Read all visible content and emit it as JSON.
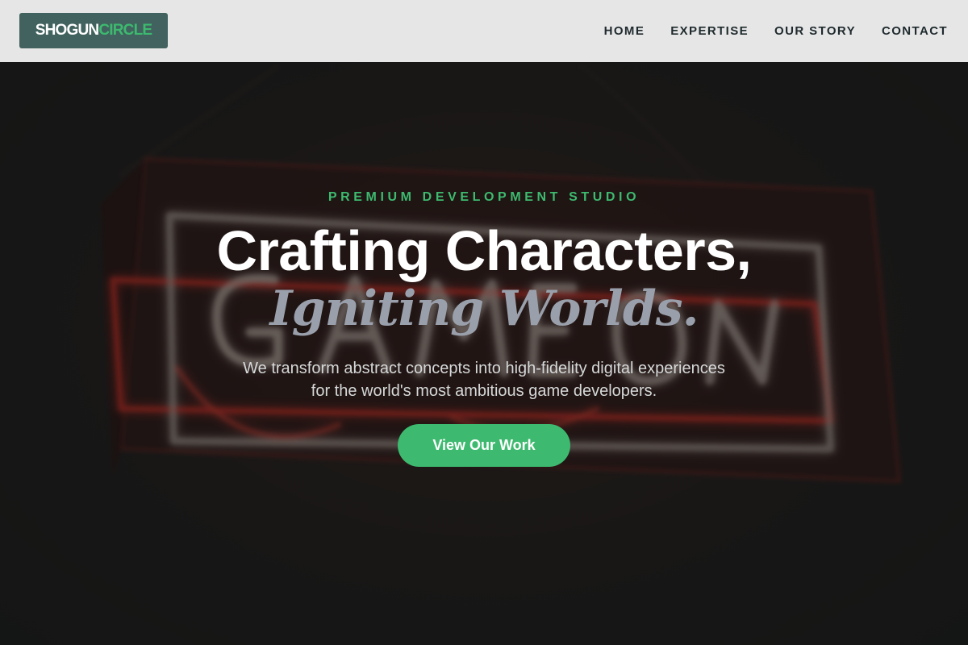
{
  "brand": {
    "name_part1": "SHOGUN",
    "name_part2": "CIRCLE"
  },
  "nav": {
    "items": [
      {
        "label": "HOME"
      },
      {
        "label": "EXPERTISE"
      },
      {
        "label": "OUR STORY"
      },
      {
        "label": "CONTACT"
      }
    ]
  },
  "hero": {
    "background_image": "neon-sign-image",
    "eyebrow": "PREMIUM DEVELOPMENT STUDIO",
    "headline": "Crafting Characters,",
    "headline_accent": "Igniting Worlds.",
    "description_line1": "We transform abstract concepts into high-fidelity digital experiences",
    "description_line2": "for the world's most ambitious game developers.",
    "cta_label": "View Our Work"
  },
  "colors": {
    "header_bg": "#e6e6e6",
    "logo_bg": "#41625e",
    "accent_green": "#3dba6f",
    "hero_bg": "#181a19",
    "headline_white": "#ffffff",
    "headline_accent_gray": "#9aa0ab",
    "neon_red": "#c22a22"
  }
}
